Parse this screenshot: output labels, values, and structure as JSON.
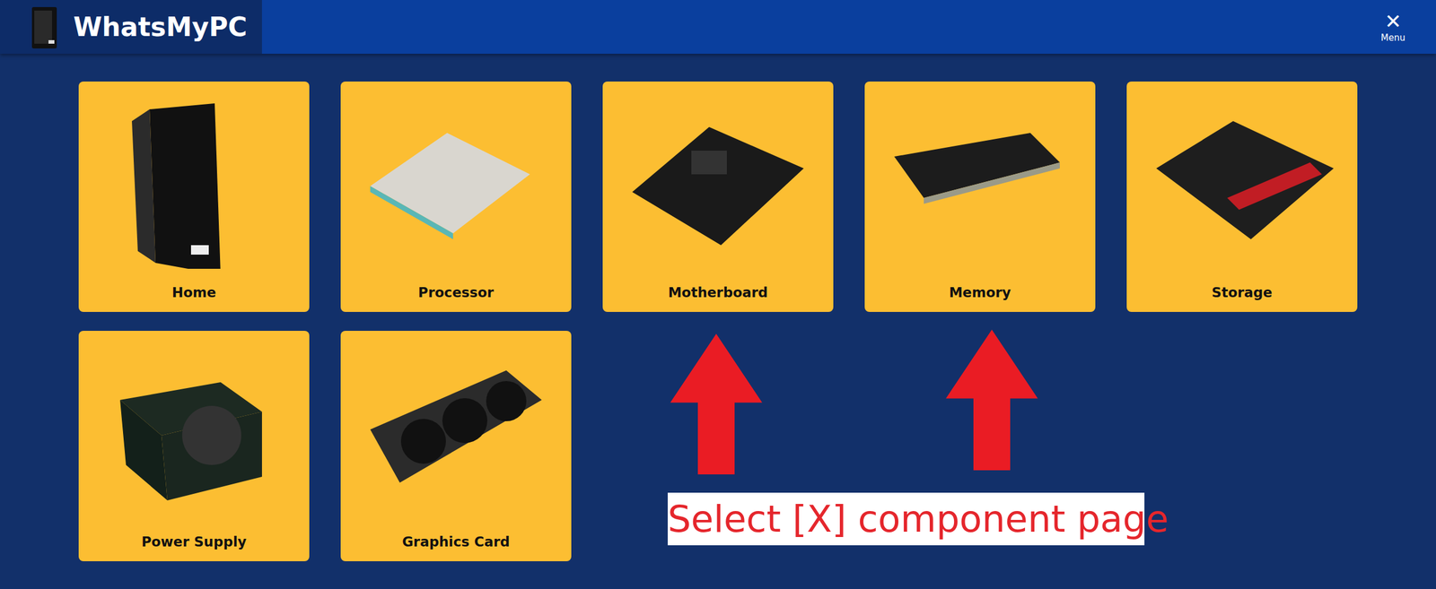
{
  "header": {
    "logo_text": "WhatsMyPC",
    "menu_icon": "✕",
    "menu_label": "Menu"
  },
  "cards": [
    {
      "label": "Home"
    },
    {
      "label": "Processor"
    },
    {
      "label": "Motherboard"
    },
    {
      "label": "Memory"
    },
    {
      "label": "Storage"
    },
    {
      "label": "Power Supply"
    },
    {
      "label": "Graphics Card"
    }
  ],
  "annotation": {
    "text": "Select [X] component page"
  }
}
